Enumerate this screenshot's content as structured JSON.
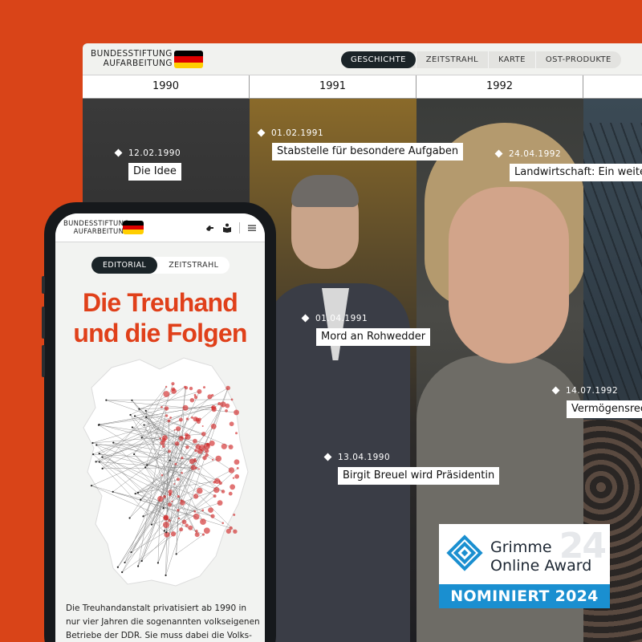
{
  "brand": {
    "line1": "BUNDESSTIFTUNG",
    "line2": "AUFARBEITUNG"
  },
  "flag_colors": [
    "#000000",
    "#dd0000",
    "#ffce00"
  ],
  "desktop": {
    "nav": [
      {
        "label": "GESCHICHTE",
        "active": true
      },
      {
        "label": "ZEITSTRAHL",
        "active": false
      },
      {
        "label": "KARTE",
        "active": false
      },
      {
        "label": "OST-PRODUKTE",
        "active": false
      }
    ],
    "years": [
      "1990",
      "1991",
      "1992",
      ""
    ],
    "events": [
      {
        "date": "12.02.1990",
        "title": "Die Idee"
      },
      {
        "date": "01.02.1991",
        "title": "Stabstelle für besondere Aufgaben"
      },
      {
        "date": "24.04.1992",
        "title": "Landwirtschaft: Ein weite"
      },
      {
        "date": "01.04.1991",
        "title": "Mord an Rohwedder"
      },
      {
        "date": "14.07.1992",
        "title": "Vermögensrec"
      },
      {
        "date": "13.04.1990",
        "title": "Birgit Breuel wird Präsidentin"
      }
    ]
  },
  "award": {
    "line1": "Grimme",
    "line2": "Online Award",
    "watermark": "24",
    "banner": "NOMINIERT 2024",
    "accent": "#1a8fd0"
  },
  "mobile": {
    "icons": [
      "sign-language-icon",
      "easy-language-icon",
      "menu-icon"
    ],
    "tabs": [
      {
        "label": "EDITORIAL",
        "active": true
      },
      {
        "label": "ZEITSTRAHL",
        "active": false
      }
    ],
    "title_line1": "Die Treuhand",
    "title_line2": "und die Folgen",
    "title_color": "#e0401a",
    "intro_lines": [
      "Die Treuhandanstalt privatisiert ab 1990 in",
      "nur vier Jahren die sogenannten volkseigenen",
      "Betriebe der DDR. Sie muss dabei die Volks-"
    ]
  },
  "background_color": "#d94418"
}
